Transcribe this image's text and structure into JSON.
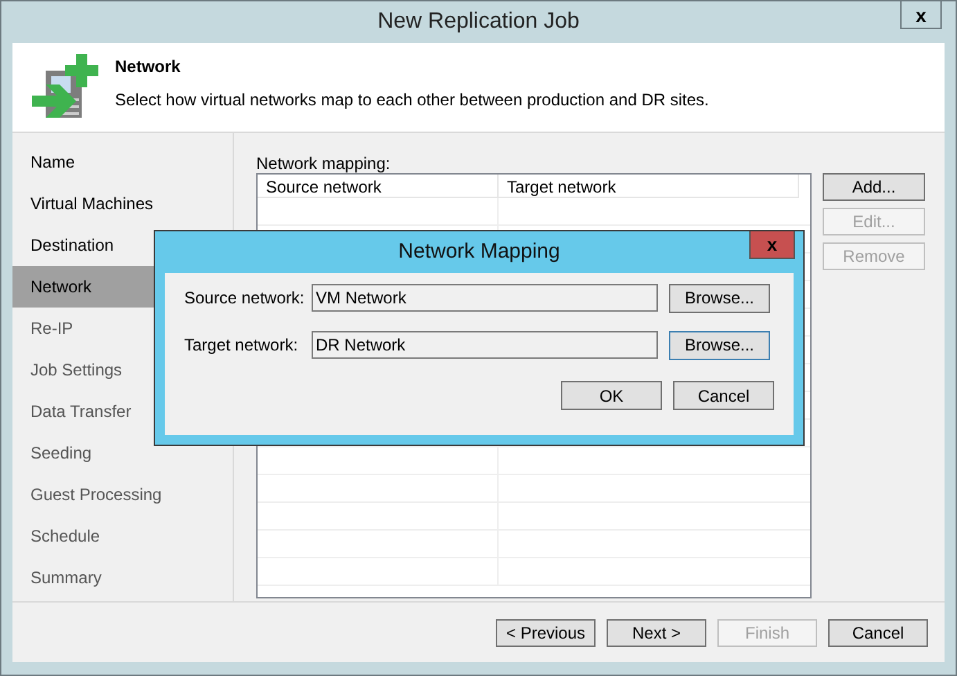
{
  "window": {
    "title": "New Replication Job",
    "close": "x"
  },
  "header": {
    "title": "Network",
    "description": "Select how virtual networks map to each other between production and DR sites."
  },
  "steps": [
    {
      "label": "Name",
      "selected": false,
      "disabled": false
    },
    {
      "label": "Virtual Machines",
      "selected": false,
      "disabled": false
    },
    {
      "label": "Destination",
      "selected": false,
      "disabled": false
    },
    {
      "label": "Network",
      "selected": true,
      "disabled": false
    },
    {
      "label": "Re-IP",
      "selected": false,
      "disabled": true
    },
    {
      "label": "Job Settings",
      "selected": false,
      "disabled": true
    },
    {
      "label": "Data Transfer",
      "selected": false,
      "disabled": true
    },
    {
      "label": "Seeding",
      "selected": false,
      "disabled": true
    },
    {
      "label": "Guest Processing",
      "selected": false,
      "disabled": true
    },
    {
      "label": "Schedule",
      "selected": false,
      "disabled": true
    },
    {
      "label": "Summary",
      "selected": false,
      "disabled": true
    }
  ],
  "mapping": {
    "label": "Network mapping:",
    "columns": [
      "Source network",
      "Target network"
    ]
  },
  "side_buttons": [
    {
      "label": "Add...",
      "disabled": false
    },
    {
      "label": "Edit...",
      "disabled": true
    },
    {
      "label": "Remove",
      "disabled": true
    }
  ],
  "dialog": {
    "title": "Network Mapping",
    "close": "x",
    "fields": [
      {
        "label": "Source network:",
        "value": "VM Network",
        "button": "Browse..."
      },
      {
        "label": "Target network:",
        "value": "DR Network",
        "button": "Browse..."
      }
    ],
    "buttons": [
      "OK",
      "Cancel"
    ]
  },
  "footer_buttons": [
    {
      "label": "< Previous",
      "disabled": false
    },
    {
      "label": "Next >",
      "disabled": false
    },
    {
      "label": "Finish",
      "disabled": true
    },
    {
      "label": "Cancel",
      "disabled": false
    }
  ]
}
